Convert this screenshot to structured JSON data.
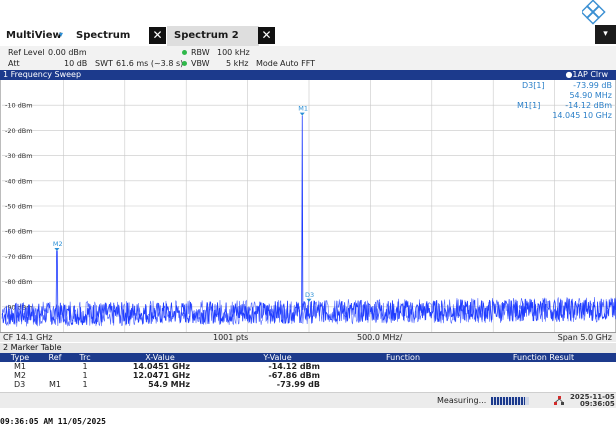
{
  "tabs": [
    {
      "label": "MultiView",
      "marker": "▾"
    },
    {
      "label": "Spectrum",
      "close": "✕"
    },
    {
      "label": "Spectrum 2",
      "close": "✕"
    }
  ],
  "menu_glyph": "▾",
  "settings": {
    "ref_level_label": "Ref Level",
    "ref_level_value": "0.00 dBm",
    "att_label": "Att",
    "att_value": "10 dB",
    "swt_label": "SWT",
    "swt_value": "61.6 ms (~3.8 s)",
    "rbw_label": "RBW",
    "rbw_value": "100 kHz",
    "vbw_label": "VBW",
    "vbw_value": "5 kHz",
    "mode_label": "Mode",
    "mode_value": "Auto FFT"
  },
  "diagram": {
    "title": "1 Frequency Sweep",
    "trace_label": "●1AP Clrw",
    "cf": "CF 14.1 GHz",
    "pts": "1001 pts",
    "div": "500.0 MHz/",
    "span": "Span 5.0 GHz"
  },
  "marker_info": [
    {
      "label": "D3[1]",
      "value": "-73.99 dB",
      "value2": "54.90 MHz"
    },
    {
      "label": "M1[1]",
      "value": "-14.12 dBm",
      "value2": "14.045 10 GHz"
    }
  ],
  "chart_data": {
    "type": "line",
    "xlabel": "",
    "ylabel": "",
    "x_center_ghz": 14.1,
    "span_ghz": 5.0,
    "xlim": [
      11.6,
      16.6
    ],
    "ylim": [
      -100,
      0
    ],
    "y_ticks": [
      "-10 dBm",
      "-20 dBm",
      "-30 dBm",
      "-40 dBm",
      "-50 dBm",
      "-60 dBm",
      "-70 dBm",
      "-80 dBm",
      "-90 dBm"
    ],
    "y_tick_values": [
      -10,
      -20,
      -30,
      -40,
      -50,
      -60,
      -70,
      -80,
      -90
    ],
    "noise_floor_dbm": -93,
    "peaks": [
      {
        "x_ghz": 14.0451,
        "y_dbm": -14.12
      },
      {
        "x_ghz": 12.0471,
        "y_dbm": -67.86
      }
    ],
    "markers": [
      {
        "name": "M1",
        "x_ghz": 14.0451,
        "y_dbm": -14.12
      },
      {
        "name": "M2",
        "x_ghz": 12.0471,
        "y_dbm": -67.86
      },
      {
        "name": "D3",
        "x_ghz": 14.1,
        "y_dbm": -88.0
      }
    ],
    "grid": true,
    "trace_color": "#1f3cff",
    "marker_color": "#2a8fd6"
  },
  "marker_table": {
    "title": "2 Marker Table",
    "columns": [
      "Type",
      "Ref",
      "Trc",
      "X-Value",
      "Y-Value",
      "Function",
      "Function Result"
    ],
    "rows": [
      [
        "M1",
        "",
        "1",
        "14.0451 GHz",
        "-14.12 dBm",
        "",
        ""
      ],
      [
        "M2",
        "",
        "1",
        "12.0471 GHz",
        "-67.86 dBm",
        "",
        ""
      ],
      [
        "D3",
        "M1",
        "1",
        "54.9 MHz",
        "-73.99 dB",
        "",
        ""
      ]
    ]
  },
  "status": {
    "measuring": "Measuring...",
    "progress": 0.9,
    "date": "2025-11-05",
    "time": "09:36:05"
  },
  "capture_stamp": "09:36:05 AM 11/05/2025",
  "colors": {
    "header_blue": "#1c3a8c",
    "trace_blue": "#1f3cff",
    "marker_cyan": "#2a8fd6",
    "indicator_green": "#2fb84a"
  }
}
